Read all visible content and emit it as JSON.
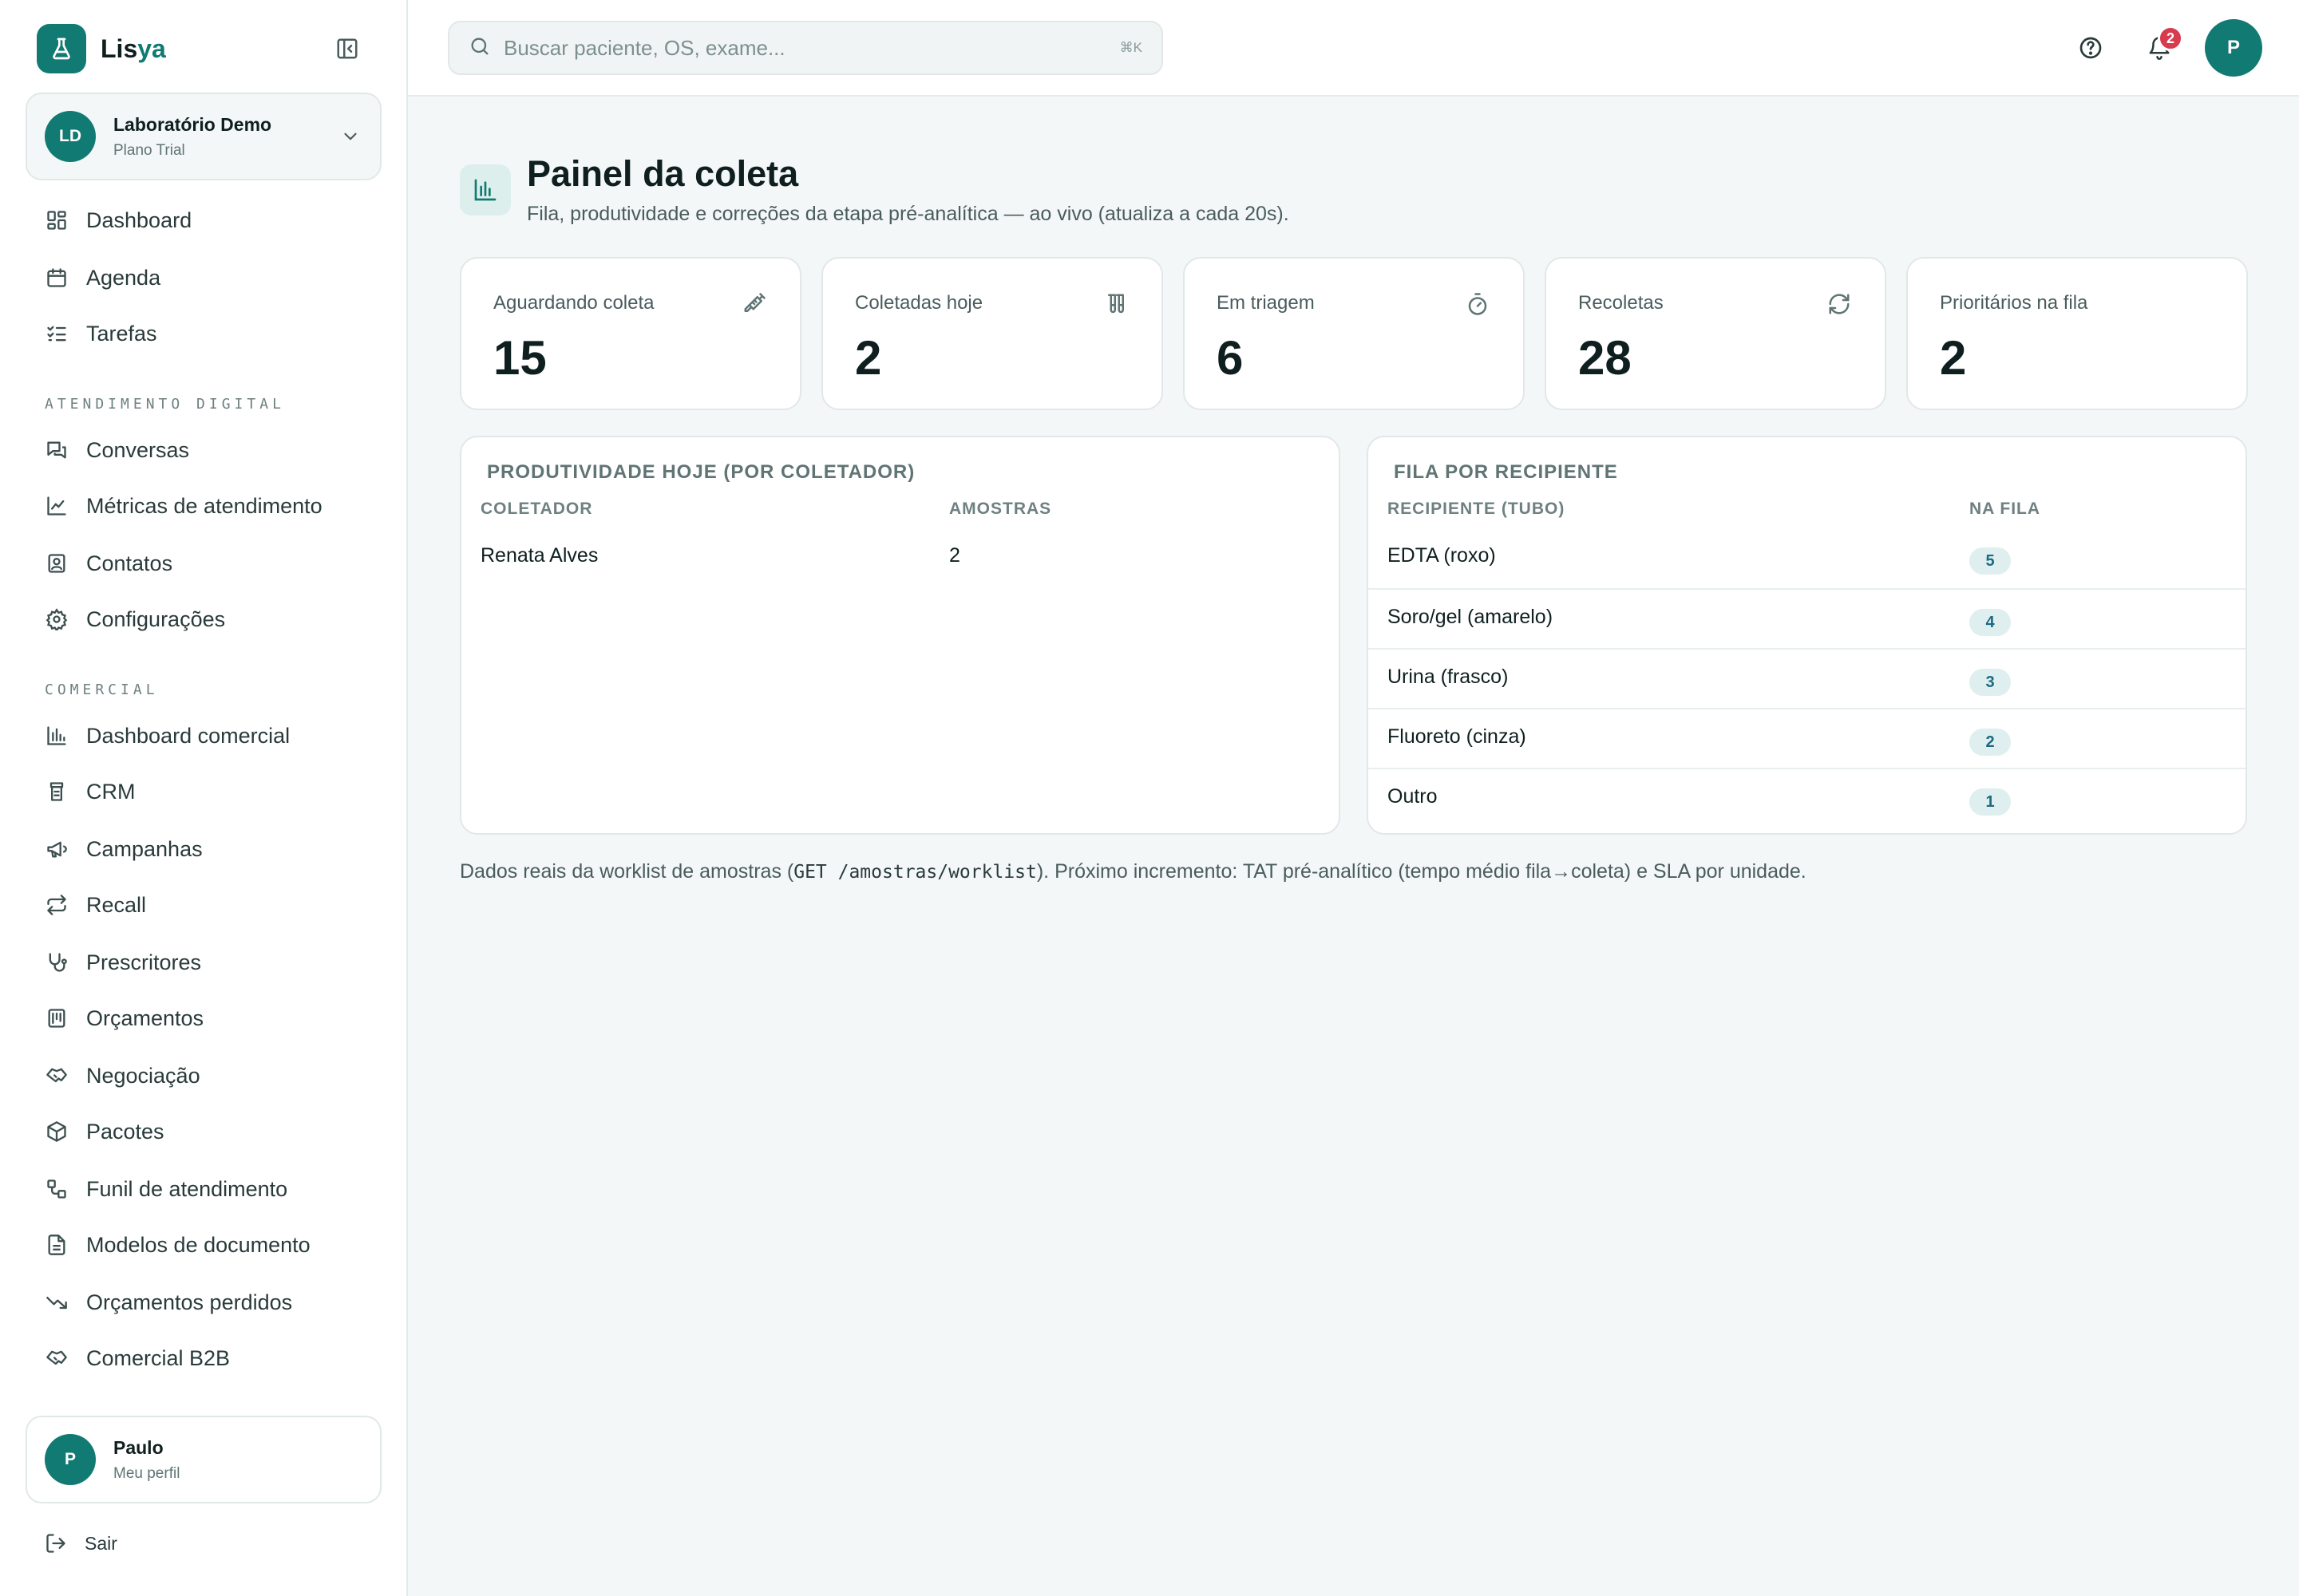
{
  "brand": {
    "name_a": "Lis",
    "name_b": "ya"
  },
  "org": {
    "initials": "LD",
    "name": "Laboratório Demo",
    "plan": "Plano Trial"
  },
  "nav": {
    "main": [
      {
        "label": "Dashboard",
        "icon": "layout-dashboard-icon"
      },
      {
        "label": "Agenda",
        "icon": "calendar-icon"
      },
      {
        "label": "Tarefas",
        "icon": "list-checks-icon"
      }
    ],
    "section_digital": "ATENDIMENTO DIGITAL",
    "digital": [
      {
        "label": "Conversas",
        "icon": "messages-icon"
      },
      {
        "label": "Métricas de atendimento",
        "icon": "line-chart-icon"
      },
      {
        "label": "Contatos",
        "icon": "contact-icon"
      },
      {
        "label": "Configurações",
        "icon": "settings-icon"
      }
    ],
    "section_comercial": "COMERCIAL",
    "comercial": [
      {
        "label": "Dashboard comercial",
        "icon": "bar-chart-icon"
      },
      {
        "label": "CRM",
        "icon": "crm-icon"
      },
      {
        "label": "Campanhas",
        "icon": "megaphone-icon"
      },
      {
        "label": "Recall",
        "icon": "repeat-icon"
      },
      {
        "label": "Prescritores",
        "icon": "stethoscope-icon"
      },
      {
        "label": "Orçamentos",
        "icon": "calculator-icon"
      },
      {
        "label": "Negociação",
        "icon": "handshake-icon"
      },
      {
        "label": "Pacotes",
        "icon": "package-icon"
      },
      {
        "label": "Funil de atendimento",
        "icon": "workflow-icon"
      },
      {
        "label": "Modelos de documento",
        "icon": "file-text-icon"
      },
      {
        "label": "Orçamentos perdidos",
        "icon": "trending-down-icon"
      },
      {
        "label": "Comercial B2B",
        "icon": "handshake-icon"
      }
    ]
  },
  "user": {
    "initial": "P",
    "name": "Paulo",
    "sub": "Meu perfil"
  },
  "logout_label": "Sair",
  "search": {
    "placeholder": "Buscar paciente, OS, exame...",
    "shortcut": "⌘K"
  },
  "notifications": {
    "count": "2"
  },
  "top_avatar": "P",
  "page": {
    "title": "Painel da coleta",
    "subtitle": "Fila, produtividade e correções da etapa pré-analítica — ao vivo (atualiza a cada 20s)."
  },
  "stats": [
    {
      "label": "Aguardando coleta",
      "value": "15",
      "icon": "syringe-icon"
    },
    {
      "label": "Coletadas hoje",
      "value": "2",
      "icon": "test-tubes-icon"
    },
    {
      "label": "Em triagem",
      "value": "6",
      "icon": "timer-icon"
    },
    {
      "label": "Recoletas",
      "value": "28",
      "icon": "refresh-icon"
    },
    {
      "label": "Prioritários na fila",
      "value": "2",
      "icon": ""
    }
  ],
  "productivity": {
    "title": "PRODUTIVIDADE HOJE (POR COLETADOR)",
    "headers": [
      "COLETADOR",
      "AMOSTRAS"
    ],
    "rows": [
      {
        "collector": "Renata Alves",
        "samples": "2"
      }
    ]
  },
  "queue": {
    "title": "FILA POR RECIPIENTE",
    "headers": [
      "RECIPIENTE (TUBO)",
      "NA FILA"
    ],
    "rows": [
      {
        "container": "EDTA (roxo)",
        "count": "5"
      },
      {
        "container": "Soro/gel (amarelo)",
        "count": "4"
      },
      {
        "container": "Urina (frasco)",
        "count": "3"
      },
      {
        "container": "Fluoreto (cinza)",
        "count": "2"
      },
      {
        "container": "Outro",
        "count": "1"
      }
    ]
  },
  "footnote": {
    "before": "Dados reais da worklist de amostras (",
    "code": "GET /amostras/worklist",
    "after": "). Próximo incremento: TAT pré-analítico (tempo médio fila→coleta) e SLA por unidade."
  },
  "colors": {
    "accent": "#117a72",
    "badge": "#d83a4e",
    "pill_bg": "#dfeeee",
    "pill_text": "#1b6b82"
  }
}
